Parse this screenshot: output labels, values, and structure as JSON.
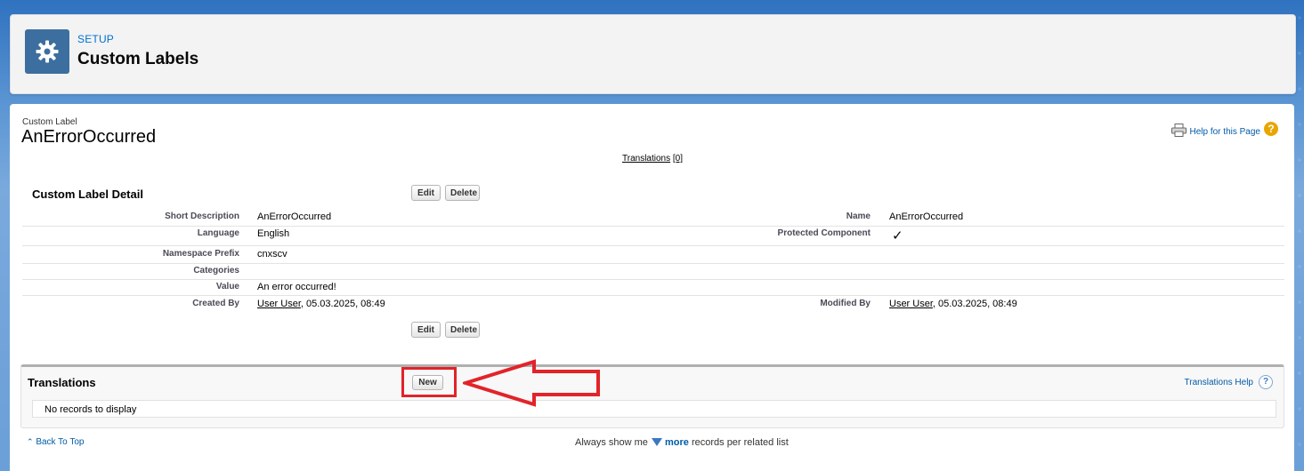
{
  "header": {
    "breadcrumb": "SETUP",
    "title": "Custom Labels",
    "icon": "gear-icon"
  },
  "record": {
    "type_label": "Custom Label",
    "name": "AnErrorOccurred"
  },
  "help": {
    "label": "Help for this Page",
    "icon_glyph": "?"
  },
  "translations_link": {
    "label": "Translations",
    "count": "[0]"
  },
  "detail": {
    "title": "Custom Label Detail",
    "edit_label": "Edit",
    "delete_label": "Delete",
    "fields": {
      "short_description": {
        "label": "Short Description",
        "value": "AnErrorOccurred"
      },
      "name": {
        "label": "Name",
        "value": "AnErrorOccurred"
      },
      "language": {
        "label": "Language",
        "value": "English"
      },
      "protected_component": {
        "label": "Protected Component",
        "value": "✓"
      },
      "namespace_prefix": {
        "label": "Namespace Prefix",
        "value": "cnxscv"
      },
      "categories": {
        "label": "Categories",
        "value": ""
      },
      "value": {
        "label": "Value",
        "value": "An error occurred!"
      },
      "created_by": {
        "label": "Created By",
        "user": "User User",
        "date": ", 05.03.2025, 08:49"
      },
      "modified_by": {
        "label": "Modified By",
        "user": "User User",
        "date": ", 05.03.2025, 08:49"
      }
    }
  },
  "translations": {
    "title": "Translations",
    "new_label": "New",
    "help_label": "Translations Help",
    "help_glyph": "?",
    "empty_text": "No records to display"
  },
  "footer": {
    "back_to_top": "Back To Top",
    "always_show": "Always show me",
    "more": "more",
    "records_per_list": "records per related list"
  },
  "colors": {
    "annotation": "#e2232a",
    "link": "#015ba7",
    "brand_icon_bg": "#3c6f9f"
  }
}
